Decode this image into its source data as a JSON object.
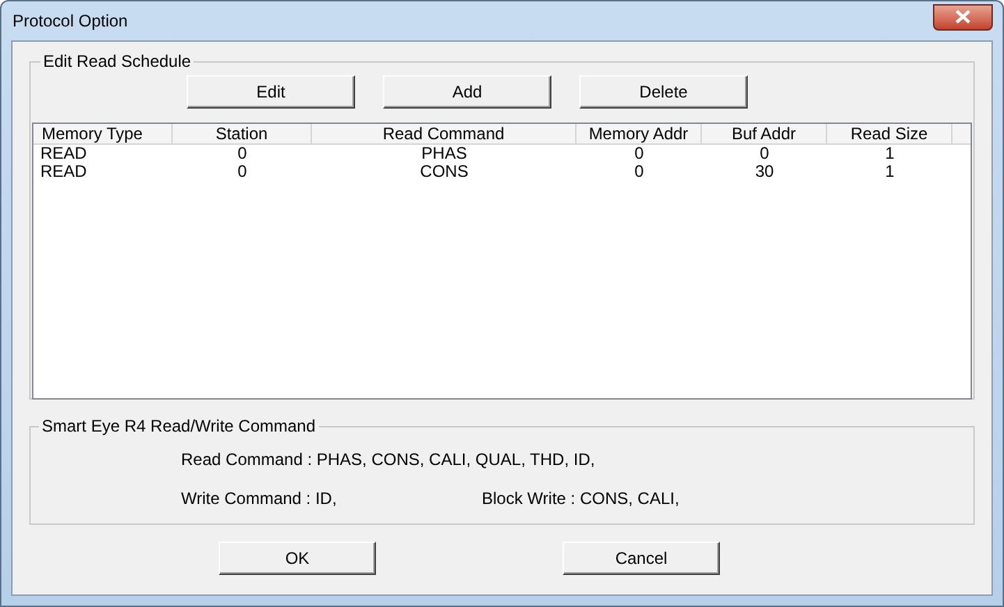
{
  "window": {
    "title": "Protocol Option"
  },
  "schedule": {
    "title": "Edit Read Schedule",
    "buttons": [
      "Edit",
      "Add",
      "Delete"
    ],
    "columns": [
      "Memory Type",
      "Station",
      "Read Command",
      "Memory Addr",
      "Buf Addr",
      "Read Size"
    ],
    "rows": [
      [
        "READ",
        "0",
        "PHAS",
        "0",
        "0",
        "1"
      ],
      [
        "READ",
        "0",
        "CONS",
        "0",
        "30",
        "1"
      ]
    ]
  },
  "commands": {
    "title": "Smart Eye R4 Read/Write Command",
    "read": "Read Command : PHAS, CONS, CALI, QUAL, THD, ID,",
    "write": "Write Command : ID,",
    "block_write": "Block Write : CONS, CALI,"
  },
  "buttons": [
    "OK",
    "Cancel"
  ]
}
